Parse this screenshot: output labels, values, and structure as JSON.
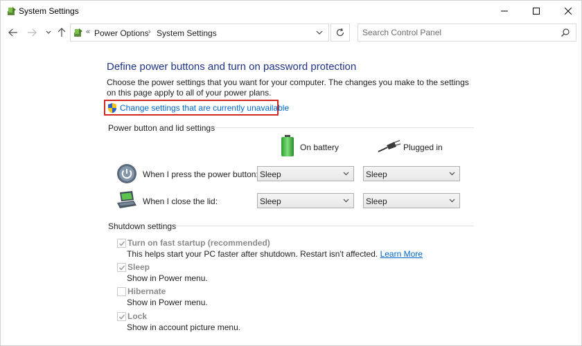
{
  "window": {
    "title": "System Settings",
    "controls": {
      "minimize": "minimize-icon",
      "maximize": "maximize-icon",
      "close": "close-icon"
    }
  },
  "nav": {
    "breadcrumb_overflow": "«",
    "breadcrumbs": [
      "Power Options",
      "System Settings"
    ],
    "separator": "›"
  },
  "search": {
    "placeholder": "Search Control Panel"
  },
  "content": {
    "title": "Define power buttons and turn on password protection",
    "description": "Choose the power settings that you want for your computer. The changes you make to the settings on this page apply to all of your power plans.",
    "change_link": "Change settings that are currently unavailable",
    "power_section": {
      "label": "Power button and lid settings",
      "columns": [
        "On battery",
        "Plugged in"
      ],
      "rows": [
        {
          "label": "When I press the power button:",
          "on_battery": "Sleep",
          "plugged_in": "Sleep",
          "icon": "power-button-icon"
        },
        {
          "label": "When I close the lid:",
          "on_battery": "Sleep",
          "plugged_in": "Sleep",
          "icon": "laptop-lid-icon"
        }
      ]
    },
    "shutdown_section": {
      "label": "Shutdown settings",
      "options": [
        {
          "label": "Turn on fast startup (recommended)",
          "checked": true,
          "desc": "This helps start your PC faster after shutdown. Restart isn't affected.",
          "link": "Learn More"
        },
        {
          "label": "Sleep",
          "checked": true,
          "desc": "Show in Power menu."
        },
        {
          "label": "Hibernate",
          "checked": false,
          "desc": "Show in Power menu."
        },
        {
          "label": "Lock",
          "checked": true,
          "desc": "Show in account picture menu."
        }
      ]
    }
  },
  "colors": {
    "title_blue": "#1e3287",
    "link_blue": "#0066cc",
    "highlight_red": "#d0281e",
    "disabled_gray": "#8a8a8a"
  }
}
